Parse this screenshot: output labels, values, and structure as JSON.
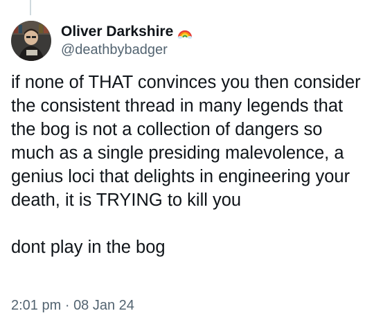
{
  "tweet": {
    "author": {
      "display_name": "Oliver Darkshire",
      "handle": "@deathbybadger",
      "badge_icon": "rainbow-icon"
    },
    "text_paragraphs": [
      "if none of THAT convinces you then consider the consistent thread in many legends that the bog is not a collection of dangers so much as a single presiding malevolence, a genius loci that delights in engineering your death, it is TRYING to kill you",
      "dont play in the bog"
    ],
    "time": "2:01 pm",
    "separator": "·",
    "date": "08 Jan 24"
  },
  "colors": {
    "text": "#0f1419",
    "secondary": "#536471",
    "thread_line": "#cfd9de"
  }
}
